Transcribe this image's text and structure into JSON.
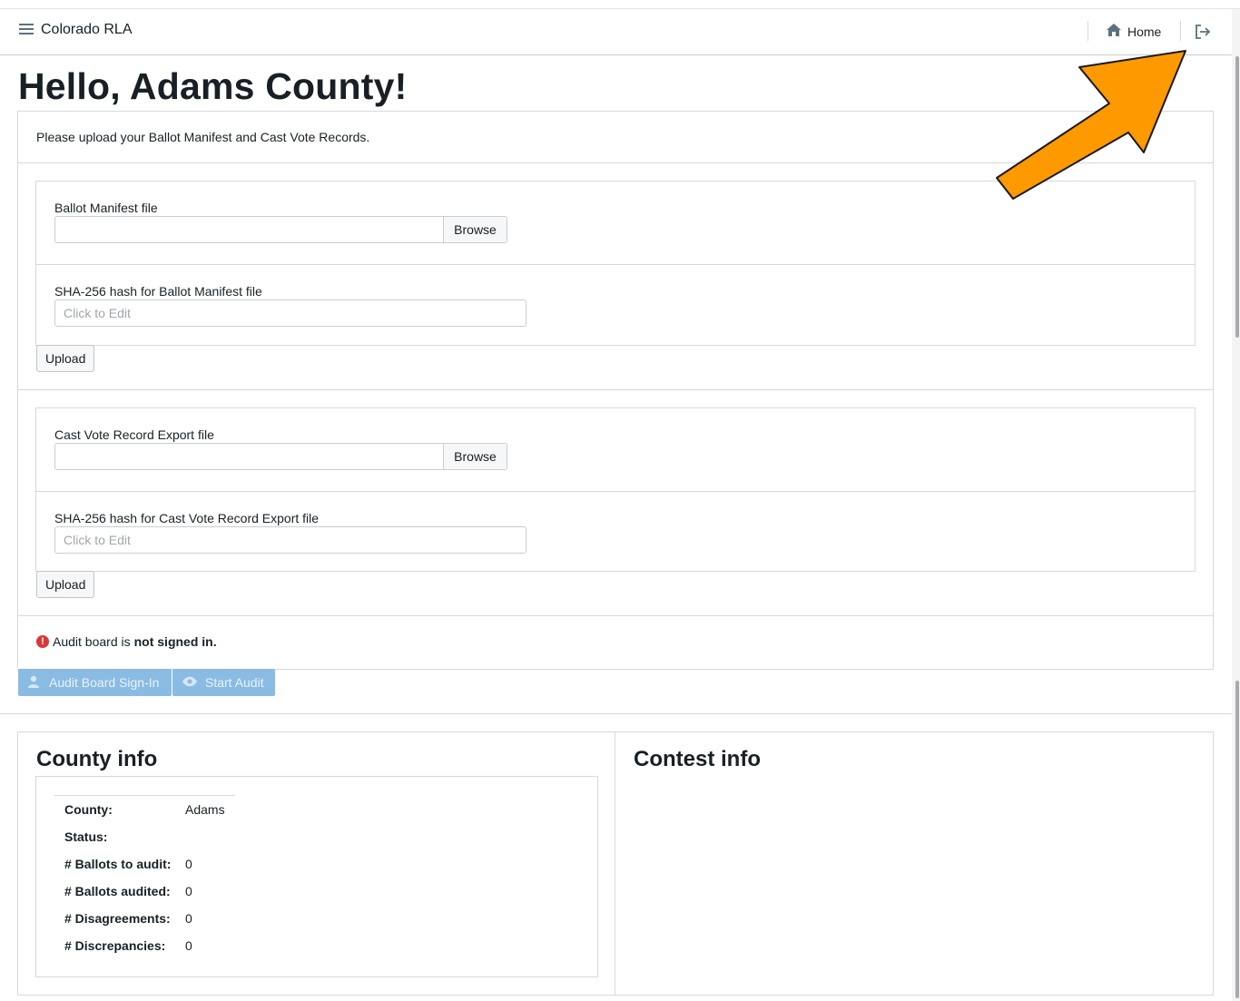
{
  "nav": {
    "title": "Colorado RLA",
    "home_label": "Home",
    "icons": [
      "menu-icon",
      "home-icon",
      "logout-icon"
    ]
  },
  "page": {
    "title": "Hello, Adams County!",
    "prompt": "Please upload your Ballot Manifest and Cast Vote Records."
  },
  "ballot_manifest": {
    "file_label": "Ballot Manifest file",
    "browse_label": "Browse",
    "hash_label": "SHA-256 hash for Ballot Manifest file",
    "hash_placeholder": "Click to Edit",
    "upload_label": "Upload"
  },
  "cvr": {
    "file_label": "Cast Vote Record Export file",
    "browse_label": "Browse",
    "hash_label": "SHA-256 hash for Cast Vote Record Export file",
    "hash_placeholder": "Click to Edit",
    "upload_label": "Upload"
  },
  "audit_status": {
    "prefix": "Audit board is",
    "status": "not signed in.",
    "sign_in_label": "Audit Board Sign-In",
    "start_audit_label": "Start Audit"
  },
  "county_info": {
    "heading": "County info",
    "rows": [
      {
        "key": "County:",
        "value": "Adams"
      },
      {
        "key": "Status:",
        "value": ""
      },
      {
        "key": "# Ballots to audit:",
        "value": "0"
      },
      {
        "key": "# Ballots audited:",
        "value": "0"
      },
      {
        "key": "# Disagreements:",
        "value": "0"
      },
      {
        "key": "# Discrepancies:",
        "value": "0"
      }
    ]
  },
  "contest_info": {
    "heading": "Contest info"
  },
  "colors": {
    "accent_arrow": "#ff9900",
    "error": "#db3737",
    "disabled_primary": "#8abbe3"
  }
}
